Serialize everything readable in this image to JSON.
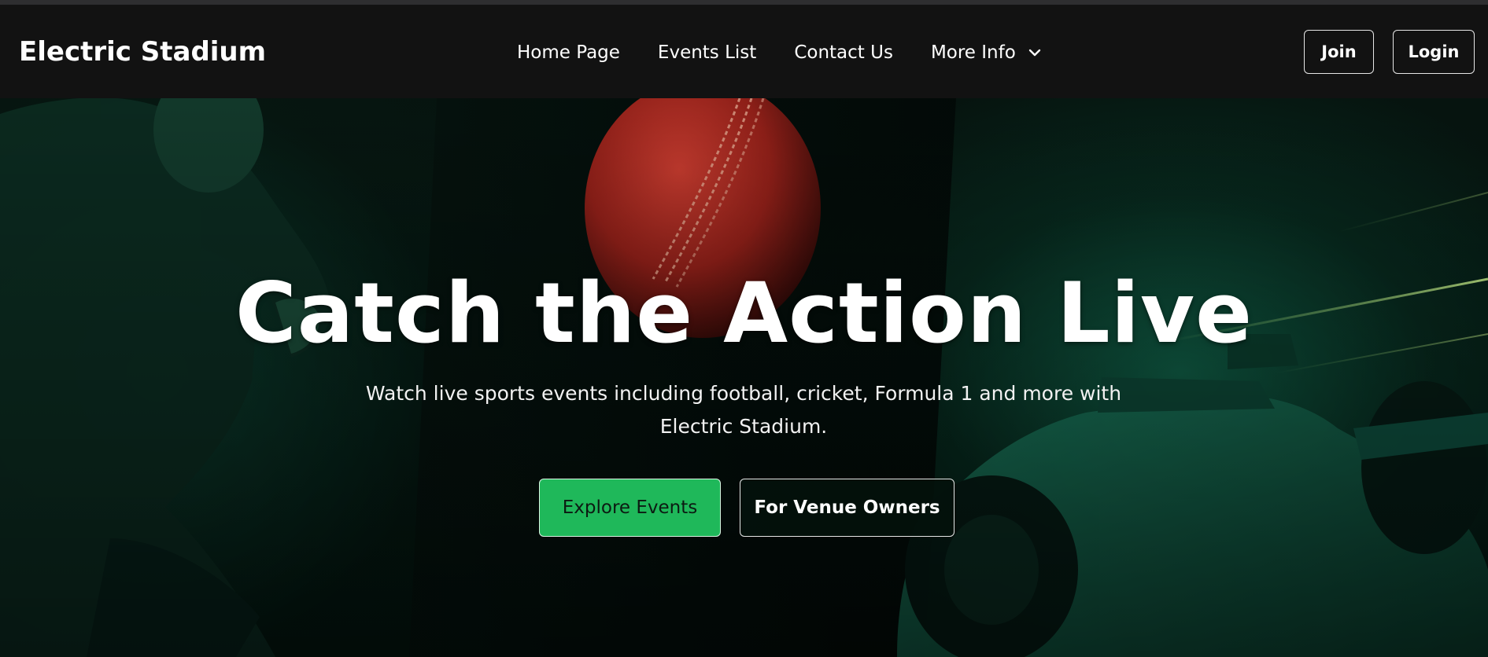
{
  "header": {
    "brand": "Electric Stadium",
    "nav": [
      {
        "label": "Home Page"
      },
      {
        "label": "Events List"
      },
      {
        "label": "Contact Us"
      },
      {
        "label": "More Info"
      }
    ],
    "join_label": "Join",
    "login_label": "Login"
  },
  "hero": {
    "title": "Catch the Action Live",
    "subtitle": "Watch live sports events including football, cricket, Formula 1 and more with Electric Stadium.",
    "primary_cta": "Explore Events",
    "secondary_cta": "For Venue Owners"
  },
  "colors": {
    "navbar_bg": "#121212",
    "accent_green": "#1fb85a",
    "hero_bg": "#041812"
  },
  "icons": {
    "more_info": "chevron-down-icon"
  }
}
